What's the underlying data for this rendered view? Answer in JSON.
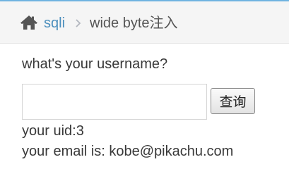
{
  "breadcrumb": {
    "home_icon": "home-icon",
    "link_label": "sqli",
    "separator_icon": "chevron-right-icon",
    "current_label": "wide byte注入"
  },
  "form": {
    "question": "what's your username?",
    "username_value": "",
    "submit_label": "查询"
  },
  "result": {
    "uid_line": "your uid:3",
    "email_line": "your email is: kobe@pikachu.com"
  },
  "colors": {
    "link": "#4c8fbd",
    "breadcrumb_bg": "#f5f5f5",
    "accent_line": "#6fb3e0",
    "text": "#393939"
  }
}
